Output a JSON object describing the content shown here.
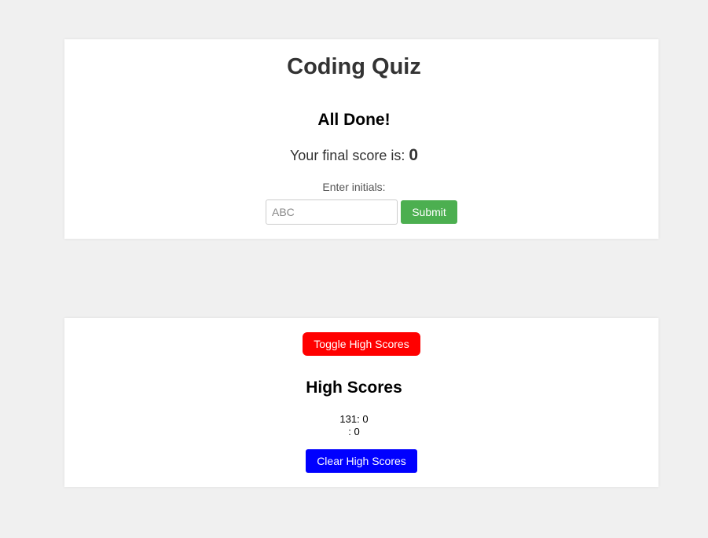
{
  "quiz": {
    "title": "Coding Quiz",
    "done_heading": "All Done!",
    "final_score_label": "Your final score is: ",
    "final_score_value": "0",
    "initials_label": "Enter initials:",
    "initials_placeholder": "ABC",
    "initials_value": "",
    "submit_label": "Submit"
  },
  "high_scores": {
    "toggle_label": "Toggle High Scores",
    "heading": "High Scores",
    "entries": [
      {
        "text": "131: 0"
      },
      {
        "text": ": 0"
      }
    ],
    "clear_label": "Clear High Scores"
  },
  "colors": {
    "background": "#f0f0f0",
    "submit": "#4caf50",
    "toggle": "#ff0000",
    "clear": "#0000ff"
  }
}
